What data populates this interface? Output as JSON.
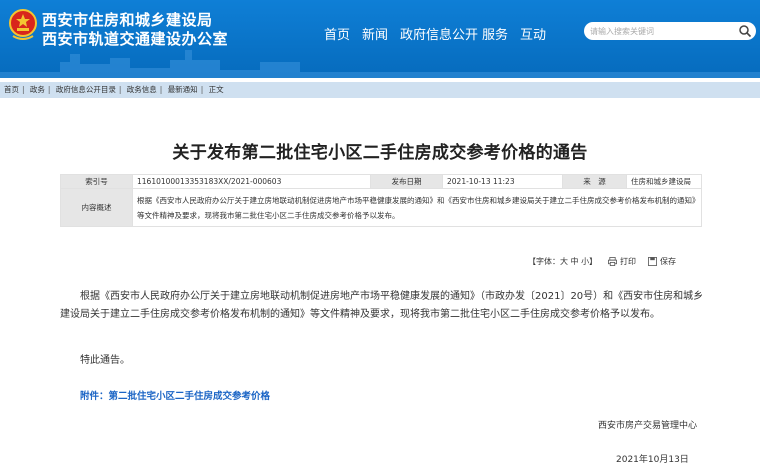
{
  "header": {
    "title_line1": "西安市住房和城乡建设局",
    "title_line2": "西安市轨道交通建设办公室",
    "nav": [
      "首页",
      "新闻",
      "政府信息公开",
      "服务",
      "互动"
    ],
    "search_placeholder": "请输入搜索关键词",
    "icons": [
      "national-emblem-icon",
      "search-icon"
    ]
  },
  "breadcrumb": [
    "首页",
    "政务",
    "政府信息公开目录",
    "政务信息",
    "最新通知",
    "正文"
  ],
  "article": {
    "title": "关于发布第二批住宅小区二手住房成交参考价格的通告",
    "meta": {
      "index_label": "索引号",
      "index_value": "11610100013353183XX/2021-000603",
      "date_label": "发布日期",
      "date_value": "2021-10-13 11:23",
      "source_label": "来　源",
      "source_value": "住房和城乡建设局",
      "summary_label": "内容概述",
      "summary_value": "根据《西安市人民政府办公厅关于建立房地联动机制促进房地产市场平稳健康发展的通知》和《西安市住房和城乡建设局关于建立二手住房成交参考价格发布机制的通知》等文件精神及要求，现将我市第二批住宅小区二手住房成交参考价格予以发布。"
    },
    "tools": {
      "font": "【字体：大 中 小】",
      "print": "打印",
      "save": "保存"
    },
    "paragraph1": "根据《西安市人民政府办公厅关于建立房地联动机制促进房地产市场平稳健康发展的通知》（市政办发〔2021〕20号）和《西安市住房和城乡建设局关于建立二手住房成交参考价格发布机制的通知》等文件精神及要求，现将我市第二批住宅小区二手住房成交参考价格予以发布。",
    "paragraph2": "特此通告。",
    "attachment": "附件：第二批住宅小区二手住房成交参考价格",
    "signature_org": "西安市房产交易管理中心",
    "signature_date": "2021年10月13日"
  },
  "colors": {
    "header_blue": "#0a73c8",
    "breadcrumb_bg": "#cfe0f0",
    "link_blue": "#1a64c5",
    "meta_label_bg": "#e6e6e6"
  }
}
